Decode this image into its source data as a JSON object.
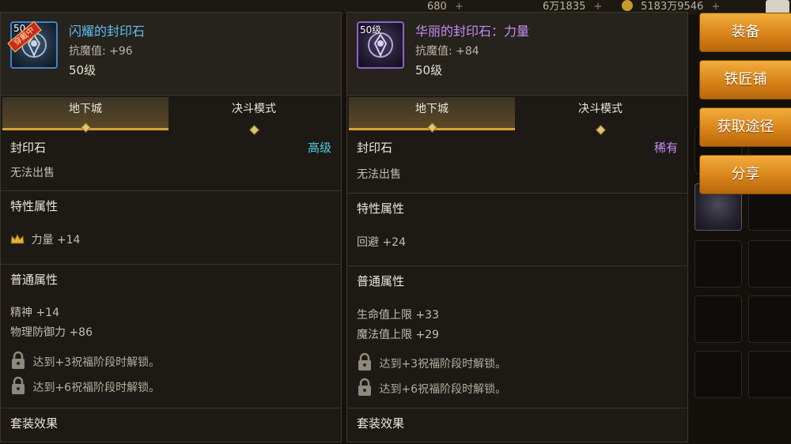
{
  "topbar": {
    "currency1": "680",
    "currency2": "6万1835",
    "currency3": "5183万9546",
    "plus": "+"
  },
  "left_panel": {
    "level_badge": "50",
    "equipped_tag": "穿戴中",
    "item_name": "闪耀的封印石",
    "item_stat": "抗魔值: +96",
    "item_level": "50级",
    "tabs": [
      {
        "label": "地下城",
        "active": true
      },
      {
        "label": "决斗模式",
        "active": false
      }
    ],
    "type_label": "封印石",
    "grade": "高级",
    "sell_note": "无法出售",
    "trait_title": "特性属性",
    "trait_value": "力量 +14",
    "common_title": "普通属性",
    "common_values": [
      "精神 +14",
      "物理防御力 +86"
    ],
    "locks": [
      "达到+3祝福阶段时解锁。",
      "达到+6祝福阶段时解锁。"
    ],
    "set_title": "套装效果"
  },
  "right_panel": {
    "level_badge": "50级",
    "item_name": "华丽的封印石：力量",
    "item_stat": "抗魔值: +84",
    "item_level": "50级",
    "tabs": [
      {
        "label": "地下城",
        "active": true
      },
      {
        "label": "决斗模式",
        "active": false
      }
    ],
    "type_label": "封印石",
    "grade": "稀有",
    "sell_note": "无法出售",
    "trait_title": "特性属性",
    "trait_value": "回避 +24",
    "common_title": "普通属性",
    "common_values": [
      "生命值上限 +33",
      "魔法值上限 +29"
    ],
    "locks": [
      "达到+3祝福阶段时解锁。",
      "达到+6祝福阶段时解锁。"
    ],
    "set_title": "套装效果"
  },
  "side_buttons": [
    "装备",
    "铁匠铺",
    "获取途径",
    "分享"
  ],
  "colors": {
    "accent_gold": "#d8a236",
    "grade_high": "#57c7e6",
    "grade_rare": "#c58cf5",
    "button_orange": "#d88419"
  },
  "icons": [
    "crown-icon",
    "lock-icon",
    "seal-stone-icon",
    "coin-icon",
    "mail-icon"
  ]
}
